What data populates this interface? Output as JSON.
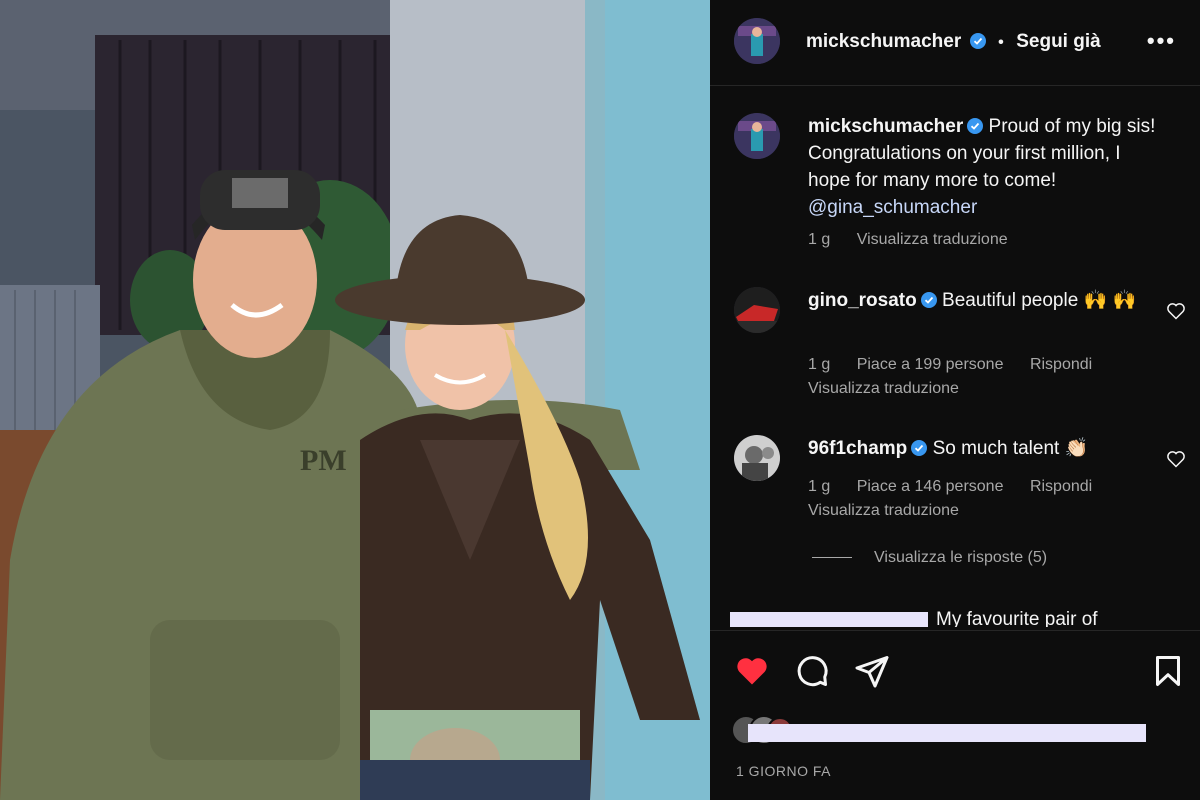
{
  "post": {
    "username": "mickschumacher",
    "follow_label": "Segui già",
    "more_label": "•••",
    "separator": "•"
  },
  "caption": {
    "username": "mickschumacher",
    "text": "Proud of my big sis! Congratulations on your first million, I hope for many more to come! ",
    "mention": "@gina_schumacher",
    "time": "1 g",
    "translate": "Visualizza traduzione"
  },
  "comments": [
    {
      "username": "gino_rosato",
      "text": "Beautiful people 🙌 🙌",
      "time": "1 g",
      "likes": "Piace a 199 persone",
      "reply": "Rispondi",
      "translate": "Visualizza traduzione"
    },
    {
      "username": "96f1champ",
      "text": "So much talent 👏🏻",
      "time": "1 g",
      "likes": "Piace a 146 persone",
      "reply": "Rispondi",
      "translate": "Visualizza traduzione"
    }
  ],
  "view_replies": "Visualizza le risposte (5)",
  "partial_comment": "My favourite pair of",
  "time_ago": "1 GIORNO FA",
  "icons": {
    "like": "heart-icon",
    "comment": "comment-icon",
    "share": "share-icon",
    "save": "bookmark-icon",
    "verified": "verified-badge-icon",
    "comment_like": "heart-outline-icon"
  },
  "colors": {
    "background": "#0d0d0d",
    "verified": "#3897f0",
    "like_red": "#ff3040",
    "muted": "#a8a8a8"
  }
}
